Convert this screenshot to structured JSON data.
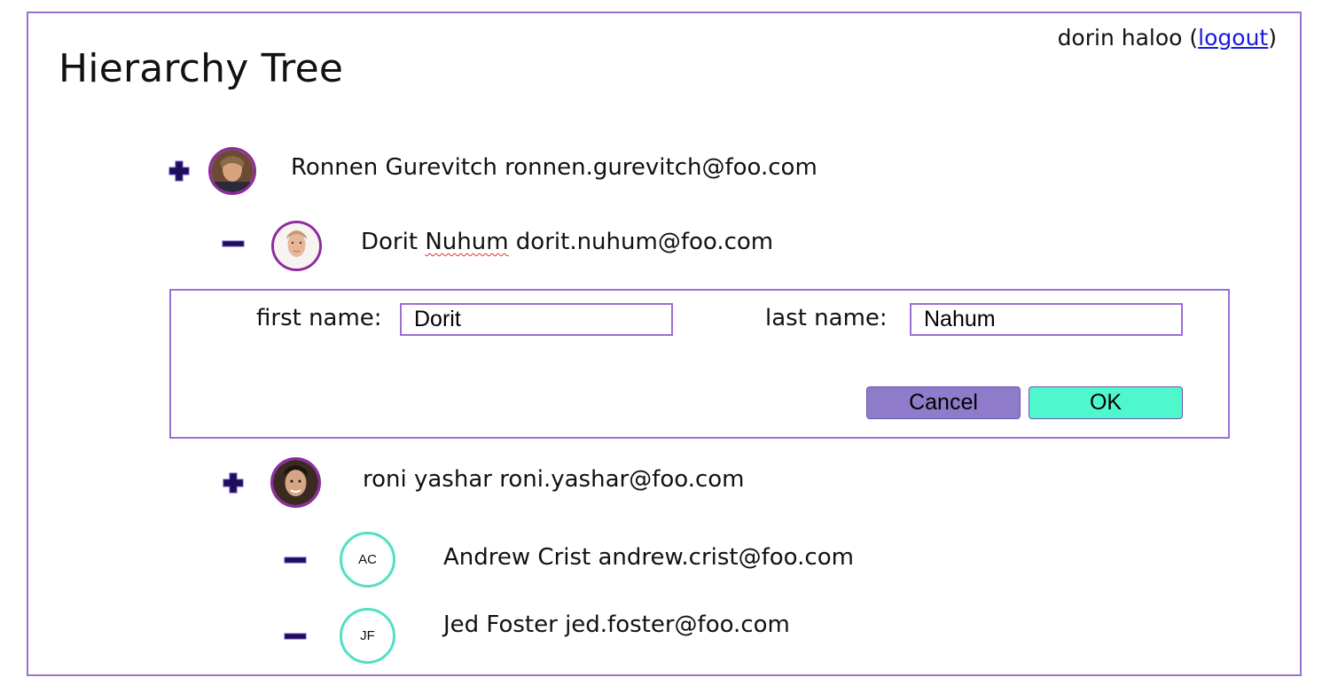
{
  "header": {
    "title": "Hierarchy Tree",
    "user_name": "dorin haloo",
    "logout_open": "(",
    "logout_label": "logout",
    "logout_close": ")"
  },
  "tree": {
    "nodes": [
      {
        "toggle": "plus-icon",
        "name": "Ronnen Gurevitch",
        "email": "ronnen.gurevitch@foo.com",
        "avatar": "photo"
      },
      {
        "toggle": "minus-icon",
        "first": "Dorit",
        "last": "Nuhum",
        "email": "dorit.nuhum@foo.com",
        "avatar": "photo"
      },
      {
        "toggle": "plus-icon",
        "name": "roni yashar",
        "email": "roni.yashar@foo.com",
        "avatar": "photo"
      },
      {
        "toggle": "minus-icon",
        "name": "Andrew Crist",
        "email": "andrew.crist@foo.com",
        "avatar_initials": "AC"
      },
      {
        "toggle": "minus-icon",
        "name": "Jed Foster",
        "email": "jed.foster@foo.com",
        "avatar_initials": "JF"
      }
    ]
  },
  "edit_form": {
    "first_name_label": "first name:",
    "first_name_value": "Dorit",
    "last_name_label": "last name:",
    "last_name_value": "Nahum",
    "cancel_label": "Cancel",
    "ok_label": "OK"
  },
  "colors": {
    "frame_border": "#9a6fd6",
    "photo_ring": "#8e2aa0",
    "initials_ring": "#52e0c4",
    "cancel_button": "#8e7bc9",
    "ok_button": "#4ff7cd",
    "link": "#1a1adb"
  }
}
